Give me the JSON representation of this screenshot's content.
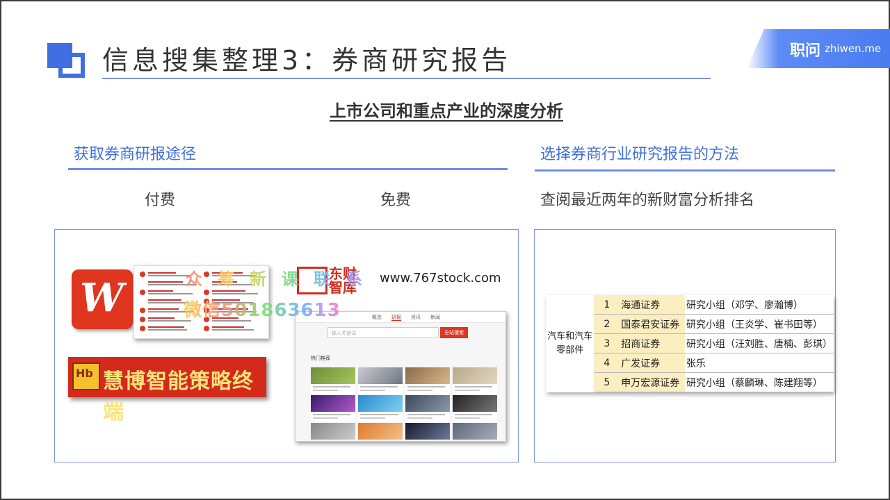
{
  "header": {
    "title": "信息搜集整理3：券商研究报告",
    "brand_cn": "职问",
    "brand_en": "zhiwen.me"
  },
  "subtitle": "上市公司和重点产业的深度分析",
  "left_section": {
    "title": "获取券商研报途径",
    "paid_label": "付费",
    "free_label": "免费",
    "huibo_text": "慧博智能策略终端",
    "huibo_icon_text": "Hb",
    "wind_letter": "W",
    "dongcai_text": "东财智库",
    "stock_url": "www.767stock.com",
    "web_tabs": [
      "概念",
      "研报",
      "资讯",
      "新闻"
    ],
    "web_search_placeholder": "输入关键词",
    "web_search_button": "全站搜索",
    "web_hot_label": "热门推荐"
  },
  "watermark": {
    "line1": "众筹新课联系",
    "line2": "微信501863613"
  },
  "right_section": {
    "title": "选择券商行业研究报告的方法",
    "description": "查阅最近两年的新财富分析排名",
    "table": {
      "sector": "汽车和汽车零部件",
      "rows": [
        {
          "rank": "1",
          "firm": "海通证券",
          "team": "研究小组（邓学、廖瀚博）"
        },
        {
          "rank": "2",
          "firm": "国泰君安证券",
          "team": "研究小组（王炎学、崔书田等）"
        },
        {
          "rank": "3",
          "firm": "招商证券",
          "team": "研究小组（汪刘胜、唐楠、彭琪）"
        },
        {
          "rank": "4",
          "firm": "广发证券",
          "team": "张乐"
        },
        {
          "rank": "5",
          "firm": "申万宏源证券",
          "team": "研究小组（蔡麟琳、陈建翔等）"
        }
      ]
    }
  },
  "colors": {
    "accent": "#3f6fe0",
    "line": "#6f8de8",
    "brand_red": "#d42a1c",
    "table_highlight": "#fbeec1"
  }
}
